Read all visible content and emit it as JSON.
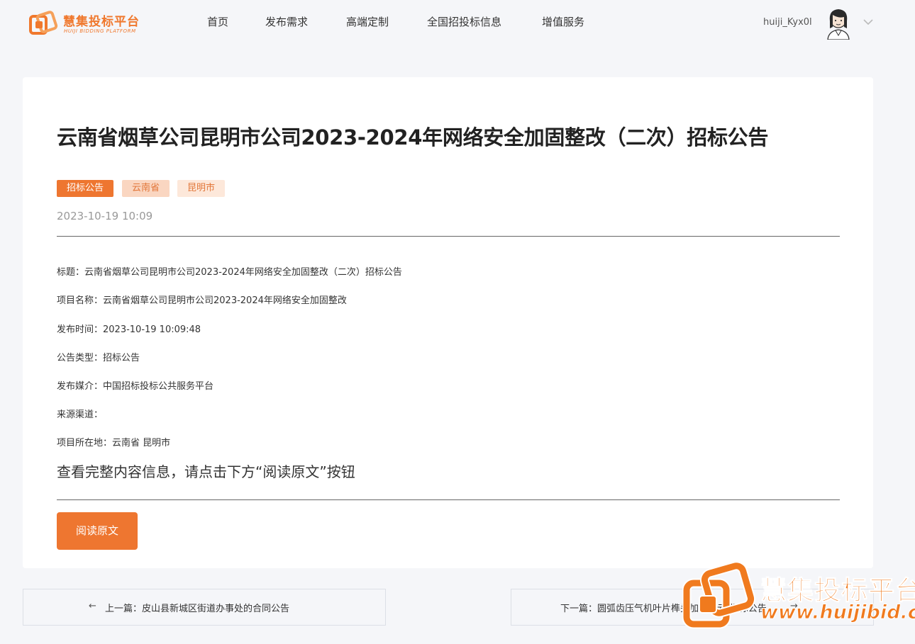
{
  "header": {
    "logo_cn": "慧集投标平台",
    "logo_en": "HUIJI BIDDING PLATFORM",
    "nav": [
      "首页",
      "发布需求",
      "高端定制",
      "全国招投标信息",
      "增值服务"
    ],
    "user_name": "huiji_Kyx0l"
  },
  "article": {
    "title": "云南省烟草公司昆明市公司2023-2024年网络安全加固整改（二次）招标公告",
    "tags": [
      "招标公告",
      "云南省",
      "昆明市"
    ],
    "date": "2023-10-19 10:09",
    "fields": [
      "标题：云南省烟草公司昆明市公司2023-2024年网络安全加固整改（二次）招标公告",
      "项目名称：云南省烟草公司昆明市公司2023-2024年网络安全加固整改",
      "发布时间：2023-10-19 10:09:48",
      "公告类型：招标公告",
      "发布媒介：中国招标投标公共服务平台",
      "来源渠道：",
      "项目所在地：云南省 昆明市"
    ],
    "hint": "查看完整内容信息，请点击下方“阅读原文”按钮",
    "read_button": "阅读原文"
  },
  "pager": {
    "prev": "上一篇：皮山县新城区街道办事处的合同公告",
    "next": "下一篇：圆弧齿压气机叶片榫头加工单元-招标公告",
    "prev_arrow": "←",
    "next_arrow": "→"
  },
  "watermark": {
    "cn": "慧集投标平台",
    "url": "www.huijibid.cn"
  },
  "colors": {
    "accent": "#ee7630",
    "tag_light": "#fad6c1",
    "tag_lighter": "#fde8da"
  }
}
